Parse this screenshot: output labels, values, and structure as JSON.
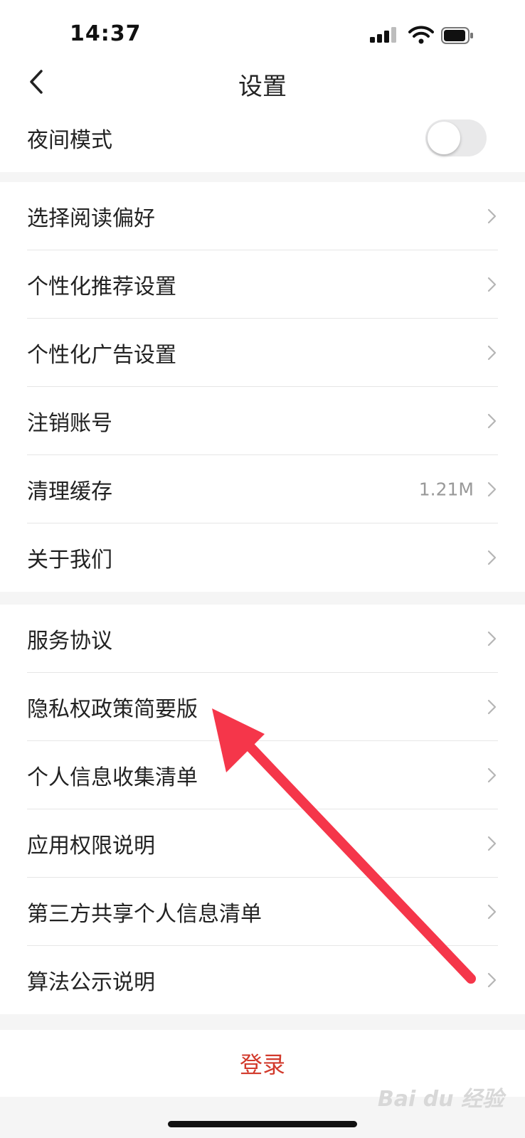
{
  "status_bar": {
    "time": "14:37"
  },
  "header": {
    "title": "设置"
  },
  "night_mode": {
    "label": "夜间模式",
    "enabled": false
  },
  "groups": [
    [
      {
        "label": "选择阅读偏好"
      },
      {
        "label": "个性化推荐设置"
      },
      {
        "label": "个性化广告设置"
      },
      {
        "label": "注销账号"
      },
      {
        "label": "清理缓存",
        "value": "1.21M"
      },
      {
        "label": "关于我们"
      }
    ],
    [
      {
        "label": "服务协议"
      },
      {
        "label": "隐私权政策简要版"
      },
      {
        "label": "个人信息收集清单"
      },
      {
        "label": "应用权限说明"
      },
      {
        "label": "第三方共享个人信息清单"
      },
      {
        "label": "算法公示说明"
      }
    ]
  ],
  "login": {
    "label": "登录"
  },
  "watermark": {
    "text": "Bai du 经验"
  },
  "colors": {
    "accent": "#d23a2c",
    "annotation_arrow": "#f5364a"
  }
}
